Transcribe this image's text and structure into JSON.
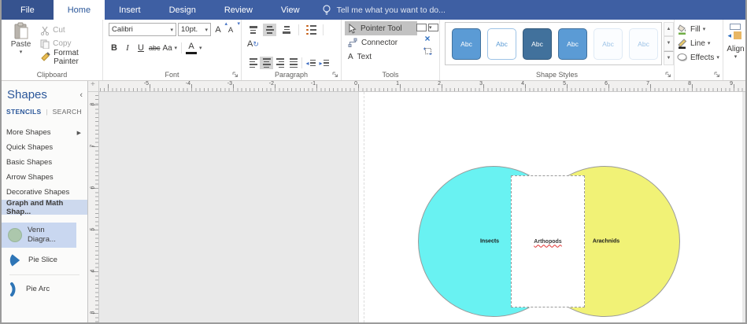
{
  "tabbar": {
    "file": "File",
    "tabs": [
      "Home",
      "Insert",
      "Design",
      "Review",
      "View"
    ],
    "active_tab": "Home",
    "tell_me": "Tell me what you want to do..."
  },
  "icons": {
    "dropdown": "▾",
    "up_arrow": "▴",
    "collapse_chevron": "‹",
    "flyout_arrow": "▶",
    "close_x": "×",
    "crosshair": "+"
  },
  "ribbon": {
    "clipboard": {
      "label": "Clipboard",
      "paste": "Paste",
      "cut": "Cut",
      "copy": "Copy",
      "format_painter": "Format Painter"
    },
    "font": {
      "label": "Font",
      "font_name": "Calibri",
      "font_size": "10pt.",
      "bold": "B",
      "italic": "I",
      "underline": "U",
      "strikethrough": "abc",
      "change_case": "Aa",
      "font_color": "A",
      "grow": "A",
      "shrink": "A"
    },
    "paragraph": {
      "label": "Paragraph",
      "rotate_letter": "A"
    },
    "tools": {
      "label": "Tools",
      "pointer_tool": "Pointer Tool",
      "connector": "Connector",
      "text": "Text",
      "text_letter": "A"
    },
    "shape_styles": {
      "label": "Shape Styles",
      "sample": "Abc",
      "styles": [
        {
          "fill": "#5b9bd5",
          "text": "#ffffff",
          "border": "#41719c"
        },
        {
          "fill": "#ffffff",
          "text": "#5b9bd5",
          "border": "#9dc3e6"
        },
        {
          "fill": "#41719c",
          "text": "#ffffff",
          "border": "#32587a"
        },
        {
          "fill": "#5b9bd5",
          "text": "#ffffff",
          "border": "#41719c"
        },
        {
          "fill": "#fbfdff",
          "text": "#9dc3e6",
          "border": "#dfeaf5"
        },
        {
          "fill": "#fbfdff",
          "text": "#9dc3e6",
          "border": "#dfeaf5"
        }
      ]
    },
    "styling": {
      "fill": "Fill",
      "line": "Line",
      "effects": "Effects"
    },
    "arrange": {
      "align": "Align"
    }
  },
  "sidebar": {
    "title": "Shapes",
    "tabs": {
      "stencils": "STENCILS",
      "search": "SEARCH"
    },
    "nav_items": [
      {
        "label": "More Shapes",
        "has_flyout": true
      },
      {
        "label": "Quick Shapes"
      },
      {
        "label": "Basic Shapes"
      },
      {
        "label": "Arrow Shapes"
      },
      {
        "label": "Decorative Shapes"
      },
      {
        "label": "Graph and Math Shap...",
        "active": true
      }
    ],
    "stencil_shapes": [
      {
        "line1": "Venn",
        "line2": "Diagra...",
        "selected": true
      },
      {
        "line1": "Pie Slice"
      },
      {
        "line1": "Pie Arc"
      }
    ]
  },
  "canvas": {
    "h_ruler_labels": [
      "-5",
      "-4",
      "-3",
      "-2",
      "-1",
      "0",
      "1",
      "2",
      "3",
      "4",
      "5",
      "6",
      "7",
      "8",
      "9"
    ],
    "v_ruler_labels": [
      "8",
      "7",
      "6",
      "5",
      "4",
      "3"
    ],
    "venn_diagram": {
      "left_circle": {
        "label": "Insects",
        "fill": "#69f2f2"
      },
      "right_circle": {
        "label": "Arachnids",
        "fill": "#f1f276"
      },
      "overlap_text_box": {
        "label": "Arthopods",
        "spellcheck_flagged": true
      }
    }
  }
}
